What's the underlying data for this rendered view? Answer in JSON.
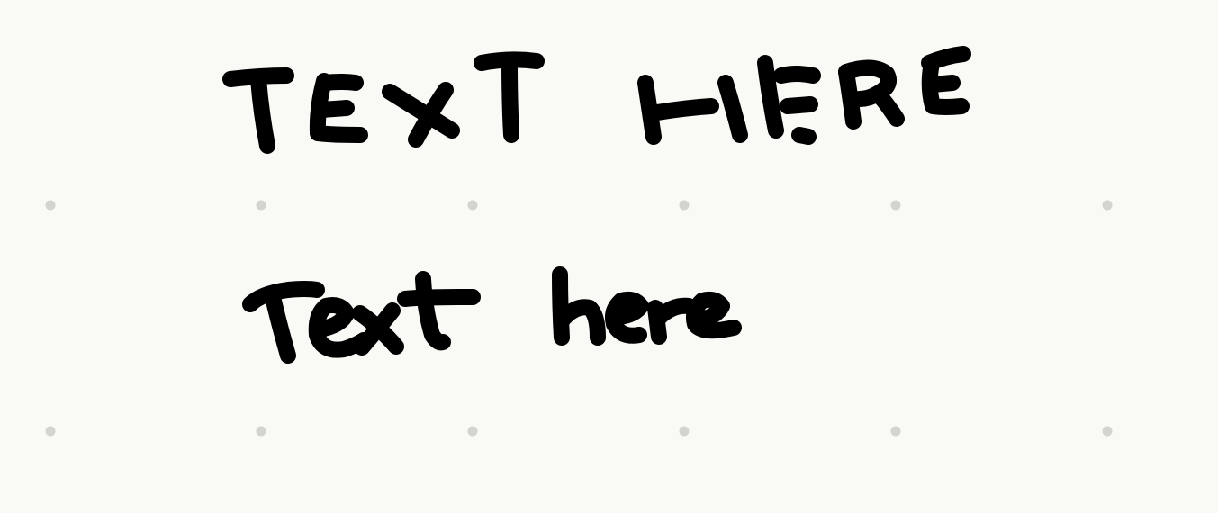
{
  "canvas": {
    "background_color": "#f9f9f6",
    "grid_dot_color": "#d3d3d0",
    "ink_color": "#000000"
  },
  "handwriting": {
    "line_uppercase": "TEXT HERE",
    "line_mixedcase": "Text here"
  }
}
